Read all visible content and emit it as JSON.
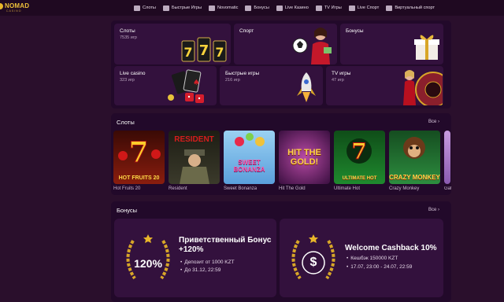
{
  "brand": {
    "name": "NOMAD",
    "sub": "CASINO"
  },
  "nav": [
    {
      "icon": "slots-icon",
      "label": "Слоты"
    },
    {
      "icon": "plane-icon",
      "label": "Быстрые Игры"
    },
    {
      "icon": "novomatic-icon",
      "label": "Novomatic"
    },
    {
      "icon": "gift-icon",
      "label": "Бонусы"
    },
    {
      "icon": "live-casino-icon",
      "label": "Live Казино"
    },
    {
      "icon": "tv-icon",
      "label": "TV Игры"
    },
    {
      "icon": "live-sport-icon",
      "label": "Live Спорт"
    },
    {
      "icon": "virtual-sport-icon",
      "label": "Виртуальный спорт"
    }
  ],
  "categories": [
    {
      "title": "Слоты",
      "count": "7535 игр"
    },
    {
      "title": "Спорт",
      "count": ""
    },
    {
      "title": "Бонусы",
      "count": ""
    },
    {
      "title": "Live casino",
      "count": "323 игр"
    },
    {
      "title": "Быстрые игры",
      "count": "216 игр"
    },
    {
      "title": "TV игры",
      "count": "47 игр"
    }
  ],
  "slots": {
    "title": "Слоты",
    "all": "Все",
    "games": [
      {
        "name": "Hot Fruits 20",
        "art": "HOT FRUITS 20",
        "color": "#8a1d0e"
      },
      {
        "name": "Resident",
        "art": "RESIDENT",
        "color": "#3b3a2b"
      },
      {
        "name": "Sweet Bonanza",
        "art": "SWEET BONANZA",
        "color": "#6fb7e8"
      },
      {
        "name": "Hit The Gold",
        "art": "HIT THE GOLD!",
        "color": "#5a1a66"
      },
      {
        "name": "Ultimate Hot",
        "art": "ULTIMATE HOT",
        "color": "#1f8a2e"
      },
      {
        "name": "Crazy Monkey",
        "art": "CRAZY MONKEY",
        "color": "#2d8d3f"
      },
      {
        "name": "Gat",
        "art": "",
        "color": "#8a5ab0"
      }
    ]
  },
  "bonuses": {
    "title": "Бонусы",
    "all": "Все",
    "cards": [
      {
        "badge": "120%",
        "title": "Приветственный Бонус +120%",
        "bullets": [
          "Депозит от 1000 KZT",
          "До 31.12, 22:59"
        ]
      },
      {
        "badge": "$",
        "title": "Welcome Cashback 10%",
        "bullets": [
          "Кешбэк 150000 KZT",
          "17.07, 23:00 - 24.07, 22:59"
        ]
      }
    ]
  }
}
